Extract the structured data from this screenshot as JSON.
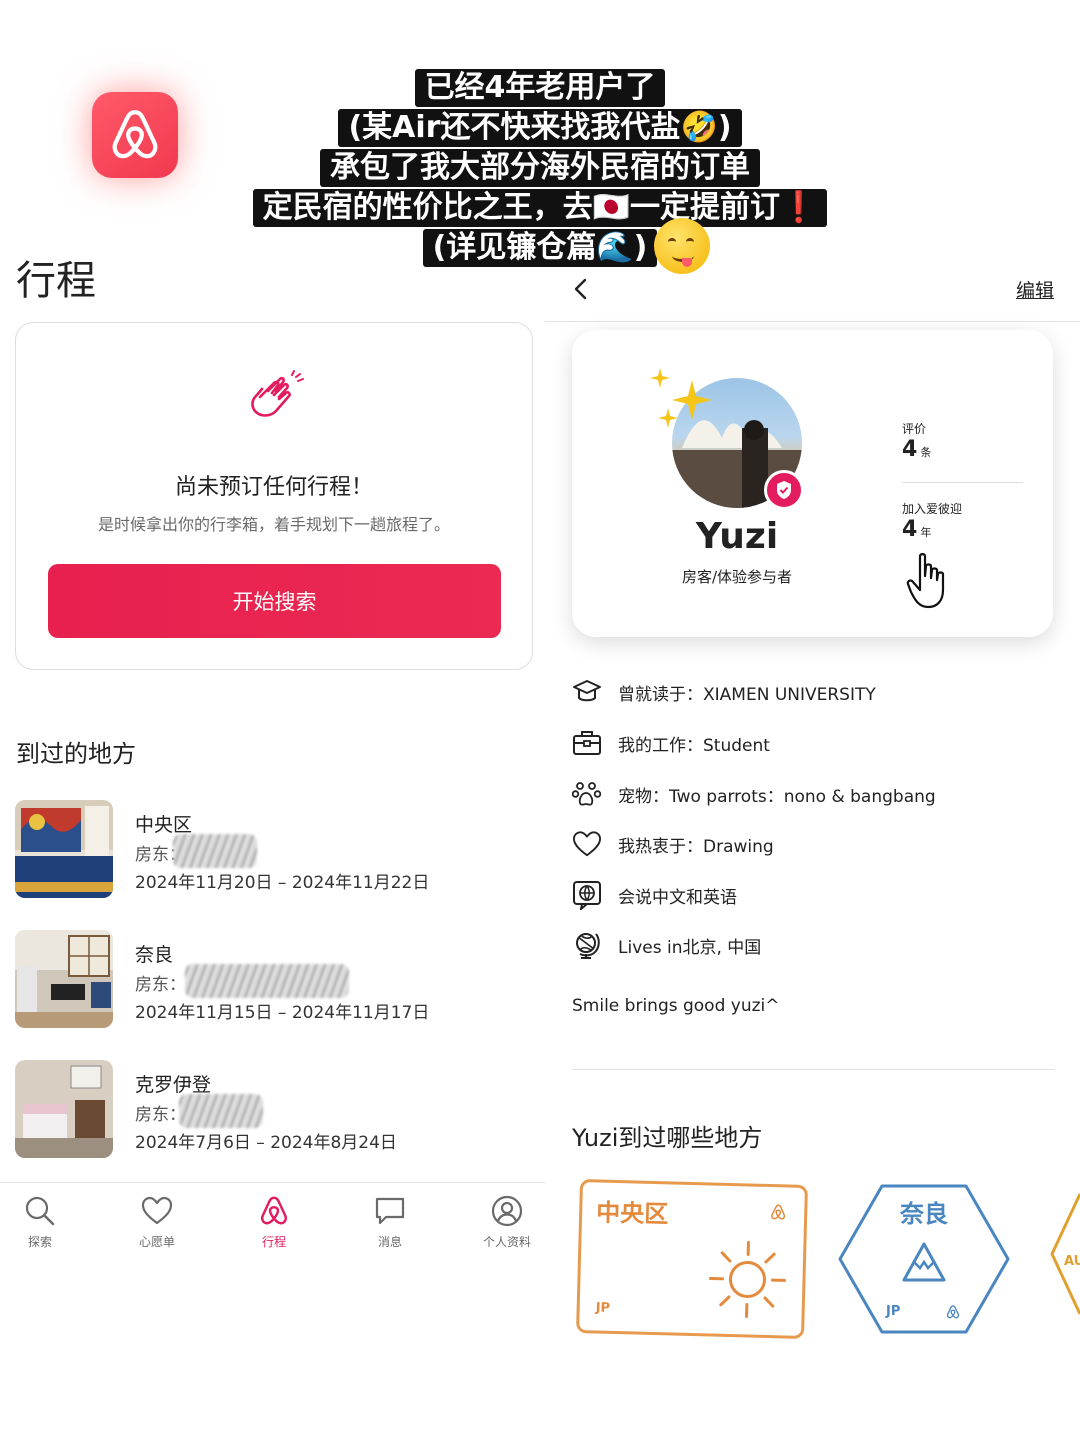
{
  "caption": {
    "lines": [
      "已经4年老用户了",
      "(某Air还不快来找我代盐🤣)",
      "承包了我大部分海外民宿的订单",
      "定民宿的性价比之王，去🇯🇵一定提前订❗",
      "(详见镰仓篇🌊)"
    ]
  },
  "left": {
    "title": "行程",
    "empty": {
      "title": "尚未预订任何行程！",
      "subtitle": "是时候拿出你的行李箱，着手规划下一趟旅程了。",
      "button": "开始搜索"
    },
    "visited_title": "到过的地方",
    "trips": [
      {
        "place": "中央区",
        "host": "房东：",
        "dates": "2024年11月20日 – 2024年11月22日"
      },
      {
        "place": "奈良",
        "host": "房东：",
        "dates": "2024年11月15日 – 2024年11月17日"
      },
      {
        "place": "克罗伊登",
        "host": "房东：",
        "dates": "2024年7月6日 – 2024年8月24日"
      }
    ],
    "nav": [
      {
        "label": "探索",
        "icon": "search-icon"
      },
      {
        "label": "心愿单",
        "icon": "heart-icon"
      },
      {
        "label": "行程",
        "icon": "airbnb-logo-icon"
      },
      {
        "label": "消息",
        "icon": "message-icon"
      },
      {
        "label": "个人资料",
        "icon": "profile-icon"
      }
    ],
    "accent": "#e31c5f"
  },
  "right": {
    "edit": "编辑",
    "profile": {
      "name": "Yuzi",
      "role": "房客/体验参与者",
      "reviews_label": "评价",
      "reviews_value": "4",
      "reviews_unit": "条",
      "joined_label": "加入爱彼迎",
      "joined_value": "4",
      "joined_unit": "年"
    },
    "info": [
      {
        "icon": "graduation-cap-icon",
        "text": "曾就读于：XIAMEN UNIVERSITY"
      },
      {
        "icon": "briefcase-icon",
        "text": "我的工作：Student"
      },
      {
        "icon": "paw-icon",
        "text": "宠物：Two parrots：nono & bangbang"
      },
      {
        "icon": "heart-icon",
        "text": "我热衷于：Drawing"
      },
      {
        "icon": "language-icon",
        "text": "会说中文和英语"
      },
      {
        "icon": "globe-icon",
        "text": "Lives in北京, 中国"
      }
    ],
    "bio": "Smile brings good yuzi^",
    "places_title": "Yuzi到过哪些地方",
    "stamps": [
      {
        "name": "中央区",
        "country": "JP",
        "color": "#e48a3c"
      },
      {
        "name": "奈良",
        "country": "JP",
        "color": "#4a86c0"
      },
      {
        "name": "AU",
        "color": "#e0a030"
      }
    ]
  }
}
